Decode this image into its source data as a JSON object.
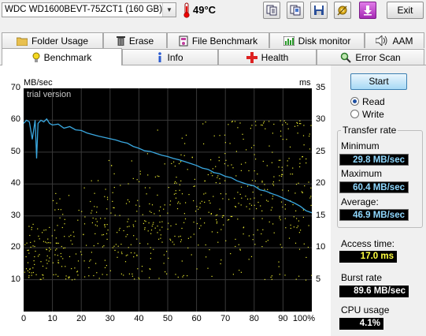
{
  "drive": {
    "selected": "WDC WD1600BEVT-75ZCT1 (160 GB)"
  },
  "temperature": "49°C",
  "toolbar": {
    "icons": [
      "copy-text-icon",
      "copy-info-icon",
      "save-icon",
      "options-icon",
      "down-arrow-icon"
    ],
    "exit_label": "Exit"
  },
  "tabs": {
    "row1": [
      {
        "label": "Folder Usage",
        "icon": "folder-icon"
      },
      {
        "label": "Erase",
        "icon": "trash-icon"
      },
      {
        "label": "File Benchmark",
        "icon": "file-benchmark-icon"
      },
      {
        "label": "Disk monitor",
        "icon": "disk-monitor-icon"
      },
      {
        "label": "AAM",
        "icon": "speaker-icon"
      }
    ],
    "row2": [
      {
        "label": "Benchmark",
        "icon": "lightbulb-icon",
        "active": true
      },
      {
        "label": "Info",
        "icon": "info-icon"
      },
      {
        "label": "Health",
        "icon": "health-cross-icon"
      },
      {
        "label": "Error Scan",
        "icon": "magnifier-icon"
      }
    ]
  },
  "chart_labels": {
    "left_unit": "MB/sec",
    "right_unit": "ms",
    "watermark": "trial version",
    "left_ticks": [
      "70",
      "60",
      "50",
      "40",
      "30",
      "20",
      "10"
    ],
    "right_ticks": [
      "35",
      "30",
      "25",
      "20",
      "15",
      "10",
      "5"
    ],
    "x_ticks": [
      "0",
      "10",
      "20",
      "30",
      "40",
      "50",
      "60",
      "70",
      "80",
      "90",
      "100%"
    ]
  },
  "chart_data": {
    "type": "line",
    "x_unit": "%",
    "xlim": [
      0,
      100
    ],
    "y_left": {
      "label": "MB/sec",
      "ylim": [
        0,
        70
      ]
    },
    "y_right": {
      "label": "ms",
      "ylim": [
        0,
        35
      ]
    },
    "grid": true,
    "series": [
      {
        "name": "Transfer rate",
        "axis": "left",
        "color": "#3aa8e0",
        "x": [
          0,
          1,
          2,
          3,
          4,
          4.5,
          5,
          6,
          7,
          8,
          9,
          10,
          12,
          14,
          16,
          18,
          20,
          22,
          24,
          26,
          28,
          30,
          32,
          34,
          36,
          38,
          40,
          42,
          44,
          46,
          48,
          50,
          52,
          54,
          56,
          58,
          60,
          62,
          64,
          66,
          68,
          70,
          72,
          74,
          76,
          78,
          80,
          82,
          84,
          86,
          88,
          90,
          92,
          94,
          96,
          98,
          100
        ],
        "y": [
          59,
          60,
          59.5,
          54,
          60,
          48,
          59,
          60,
          59.5,
          60.4,
          59,
          58.5,
          58.8,
          57.5,
          58,
          57,
          56.8,
          56,
          55.5,
          55,
          54.6,
          54.2,
          53.8,
          53.2,
          52.8,
          51.8,
          51.2,
          50.4,
          50.2,
          49.6,
          49,
          48.6,
          48,
          47.6,
          47,
          46.4,
          45.8,
          45,
          44.6,
          43.6,
          43.2,
          42.4,
          42,
          41,
          40.4,
          39.8,
          39.4,
          38.2,
          37.8,
          37,
          36.4,
          35.6,
          34.8,
          34,
          33,
          31.6,
          31
        ]
      }
    ],
    "scatter": {
      "name": "Access time",
      "axis": "right",
      "color": "#e8e830",
      "count": 700,
      "x_range": [
        0,
        100
      ],
      "y_min_ms": 5,
      "y_max_ms": 30
    }
  },
  "controls": {
    "start_label": "Start",
    "read_label": "Read",
    "write_label": "Write",
    "read_selected": true
  },
  "transfer_rate": {
    "title": "Transfer rate",
    "minimum_label": "Minimum",
    "minimum": "29.8 MB/sec",
    "maximum_label": "Maximum",
    "maximum": "60.4 MB/sec",
    "average_label": "Average:",
    "average": "46.9 MB/sec"
  },
  "access_time": {
    "label": "Access time:",
    "value": "17.0 ms"
  },
  "burst_rate": {
    "label": "Burst rate",
    "value": "89.6 MB/sec"
  },
  "cpu_usage": {
    "label": "CPU usage",
    "value": "4.1%"
  }
}
